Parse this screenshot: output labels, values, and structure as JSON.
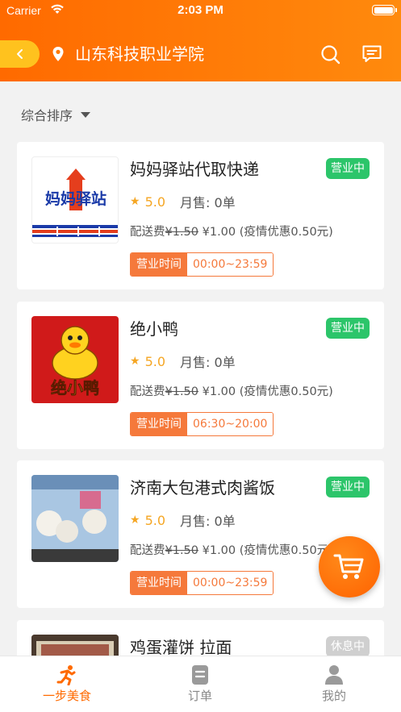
{
  "status_bar": {
    "carrier": "Carrier",
    "time": "2:03 PM"
  },
  "header": {
    "location": "山东科技职业学院"
  },
  "sort": {
    "label": "综合排序"
  },
  "stores": [
    {
      "name": "妈妈驿站代取快递",
      "status": "营业中",
      "rating": "5.0",
      "sales": "月售: 0单",
      "fee_label": "配送费",
      "fee_original": "¥1.50",
      "fee_now": "¥1.00 (疫情优惠0.50元)",
      "hours_label": "营业时间",
      "hours": "00:00~23:59",
      "logo_text": "妈妈驿站"
    },
    {
      "name": "绝小鸭",
      "status": "营业中",
      "rating": "5.0",
      "sales": "月售: 0单",
      "fee_label": "配送费",
      "fee_original": "¥1.50",
      "fee_now": "¥1.00 (疫情优惠0.50元)",
      "hours_label": "营业时间",
      "hours": "06:30~20:00",
      "logo_text": "绝小鸭"
    },
    {
      "name": "济南大包港式肉酱饭",
      "status": "营业中",
      "rating": "5.0",
      "sales": "月售: 0单",
      "fee_label": "配送费",
      "fee_original": "¥1.50",
      "fee_now": "¥1.00 (疫情优惠0.50元)",
      "hours_label": "营业时间",
      "hours": "00:00~23:59"
    },
    {
      "name": "鸡蛋灌饼 拉面",
      "status": "休息中"
    }
  ],
  "tabs": [
    {
      "label": "一步美食",
      "icon": "runner-icon",
      "active": true
    },
    {
      "label": "订单",
      "icon": "order-icon",
      "active": false
    },
    {
      "label": "我的",
      "icon": "person-icon",
      "active": false
    }
  ],
  "colors": {
    "accent": "#ff6a00",
    "open_badge": "#2cc56a",
    "closed_badge": "#cfcfcf",
    "star": "#f5a623",
    "hours_border": "#f5793b"
  }
}
